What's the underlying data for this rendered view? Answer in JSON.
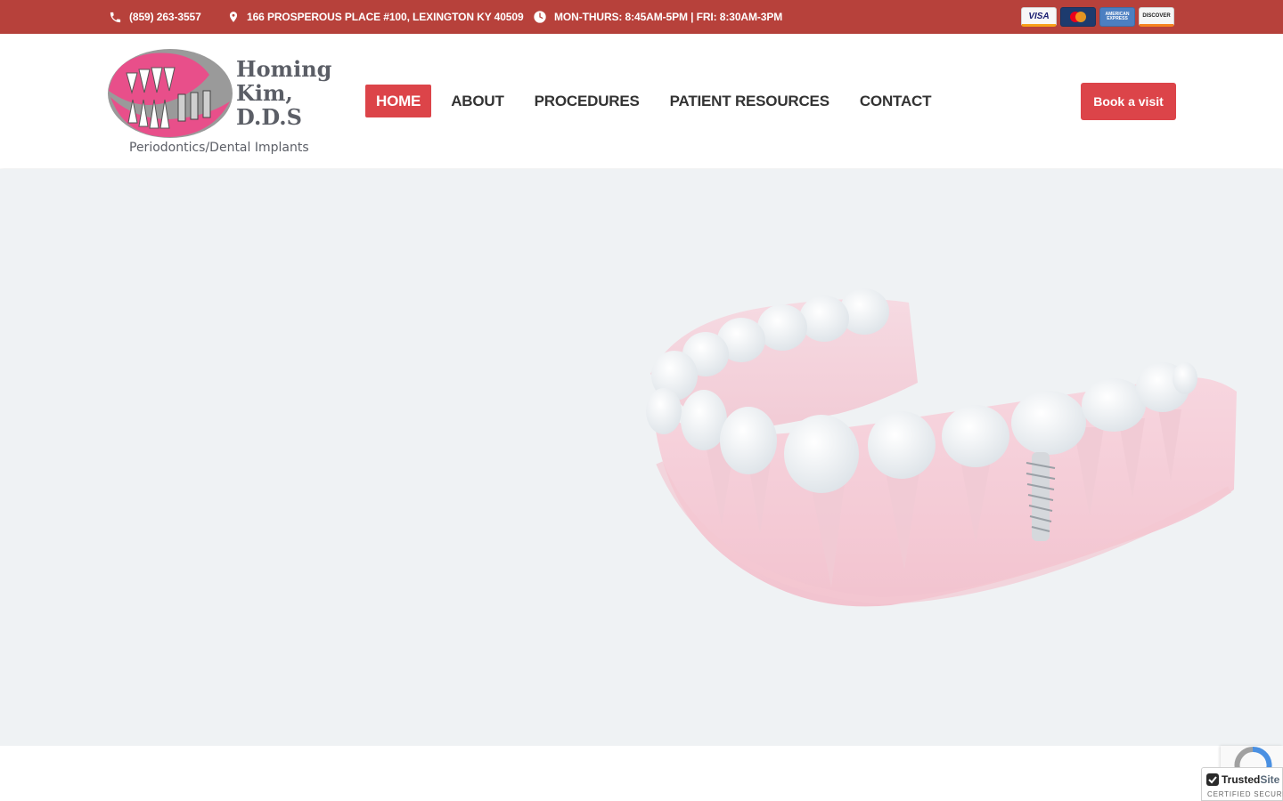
{
  "topbar": {
    "phone": "(859) 263-3557",
    "address": "166 PROSPEROUS PLACE #100, LEXINGTON KY 40509",
    "hours": "MON-THURS: 8:45AM-5PM | FRI: 8:30AM-3PM",
    "cards": [
      {
        "name": "visa",
        "label": "VISA"
      },
      {
        "name": "mastercard",
        "label": ""
      },
      {
        "name": "american-express",
        "label": "AMERICAN EXPRESS"
      },
      {
        "name": "discover",
        "label": "DISCOVER"
      }
    ],
    "bg_color": "#b7413b"
  },
  "logo": {
    "name": "Homing\nKim,\nD.D.S",
    "tagline": "Periodontics/Dental Implants"
  },
  "nav": {
    "items": [
      {
        "label": "HOME",
        "active": true
      },
      {
        "label": "ABOUT",
        "active": false
      },
      {
        "label": "PROCEDURES",
        "active": false
      },
      {
        "label": "PATIENT RESOURCES",
        "active": false
      },
      {
        "label": "CONTACT",
        "active": false
      }
    ],
    "accent": "#dc4449"
  },
  "cta": {
    "label": "Book a visit"
  },
  "badges": {
    "trusted_name_a": "Trusted",
    "trusted_name_b": "Site",
    "trusted_sub": "CERTIFIED SECURE"
  }
}
